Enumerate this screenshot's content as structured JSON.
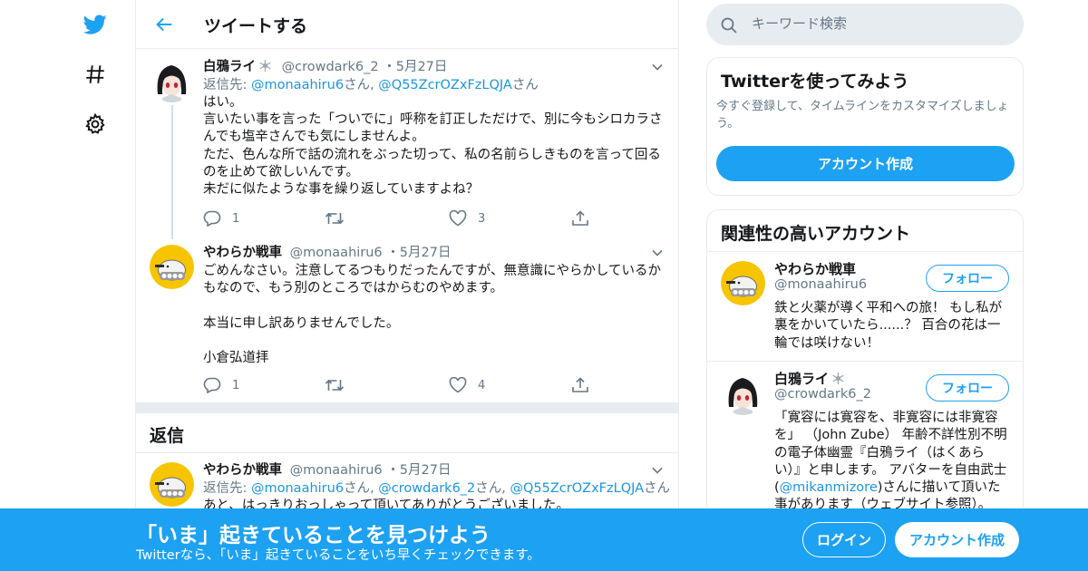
{
  "colors": {
    "brand": "#1da1f2",
    "link": "#1b95e0",
    "text": "#14171a",
    "muted": "#657786",
    "border": "#e6ecf0"
  },
  "nav": {
    "icons": [
      "twitter-bird-icon",
      "hashtag-icon",
      "gear-icon"
    ]
  },
  "header": {
    "title": "ツイートする",
    "back_icon": "arrow-left-icon"
  },
  "tweets": [
    {
      "name": "白鴉ライ",
      "handle": "@crowdark6_2",
      "sep": "・",
      "date": "5月27日",
      "reply_prefix": "返信先: ",
      "mentions": [
        "@monaahiru6",
        "@Q55ZcrOZxFzLQJA"
      ],
      "san": "さん",
      "comma": ", ",
      "text": "はい。\n言いたい事を言った「ついでに」呼称を訂正しただけで、別に今もシロカラさんでも塩辛さんでも気にしませんよ。\nただ、色んな所で話の流れをぶった切って、私の名前らしきものを言って回るのを止めて欲しいんです。\n未だに似たような事を繰り返していますよね？",
      "replies": "1",
      "likes": "3"
    },
    {
      "name": "やわらか戦車",
      "handle": "@monaahiru6",
      "sep": "・",
      "date": "5月27日",
      "text": "ごめんなさい。注意してるつもりだったんですが、無意識にやらかしているかもなので、もう別のところではからむのやめます。\n\n本当に申し訳ありませんでした。\n\n小倉弘道拝",
      "replies": "1",
      "likes": "4"
    }
  ],
  "replies_section": {
    "title": "返信"
  },
  "reply_tweet": {
    "name": "やわらか戦車",
    "handle": "@monaahiru6",
    "sep": "・",
    "date": "5月27日",
    "reply_prefix": "返信先: ",
    "mentions": [
      "@monaahiru6",
      "@crowdark6_2",
      "@Q55ZcrOZxFzLQJA"
    ],
    "san": "さん",
    "comma": ", ",
    "text": "あと、はっきりおっしゃって頂いてありがとうございました。"
  },
  "search": {
    "placeholder": "キーワード検索"
  },
  "try_card": {
    "title": "Twitterを使ってみよう",
    "subtitle": "今すぐ登録して、タイムラインをカスタマイズしましょう。",
    "button": "アカウント作成"
  },
  "related": {
    "title": "関連性の高いアカウント",
    "accounts": [
      {
        "name": "やわらか戦車",
        "handle": "@monaahiru6",
        "follow": "フォロー",
        "bio": "鉄と火薬が導く平和への旅！ もし私が裏をかいていたら......？ 百合の花は一輪では咲けない！"
      },
      {
        "name": "白鴉ライ",
        "handle": "@crowdark6_2",
        "follow": "フォロー",
        "bio_before": "「寛容には寛容を、非寛容には非寛容を」 （John Zube） 年齢不詳性別不明の電子体幽霊『白鴉ライ（はくあらい）』と申します。 アバターを自由武士(",
        "bio_mention": "@mikanmizore",
        "bio_after": ")さんに描いて頂いた事があります（ウェブサイト参照）。"
      }
    ]
  },
  "banner": {
    "title": "「いま」起きていることを見つけよう",
    "subtitle": "Twitterなら、「いま」起きていることをいち早くチェックできます。",
    "login": "ログイン",
    "signup": "アカウント作成"
  }
}
